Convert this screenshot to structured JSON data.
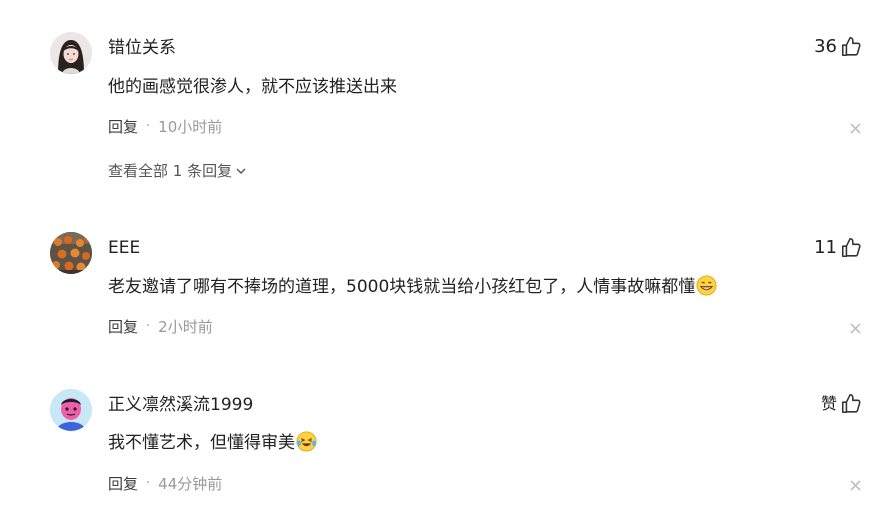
{
  "comments": [
    {
      "username": "错位关系",
      "text": "他的画感觉很渗人，就不应该推送出来",
      "likes": "36",
      "reply_label": "回复",
      "time": "10小时前",
      "avatar": "avatar-woman",
      "view_replies": "查看全部 1 条回复"
    },
    {
      "username": "EEE",
      "text": "老友邀请了哪有不捧场的道理，5000块钱就当给小孩红包了，人情事故嘛都懂",
      "emoji": "grin-emoji",
      "likes": "11",
      "reply_label": "回复",
      "time": "2小时前",
      "avatar": "avatar-crowd"
    },
    {
      "username": "正义凛然溪流1999",
      "text": "我不懂艺术，但懂得审美",
      "emoji": "laughing-tears-emoji",
      "likes": "赞",
      "reply_label": "回复",
      "time": "44分钟前",
      "avatar": "avatar-pink-character"
    }
  ],
  "separator": "·",
  "colors": {
    "text_primary": "#222222",
    "text_secondary": "#9a9a9a",
    "icon": "#333333"
  }
}
